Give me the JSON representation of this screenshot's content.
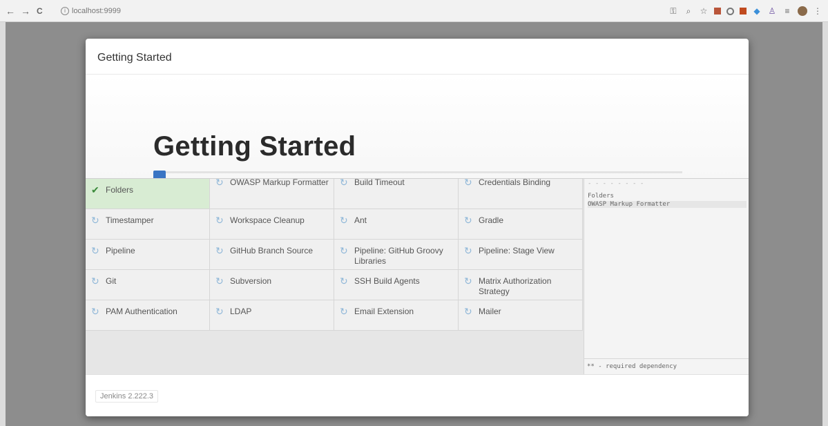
{
  "browser": {
    "back": "←",
    "forward": "→",
    "reload": "C",
    "info_glyph": "i",
    "url": "localhost:9999",
    "toolbar_icons": [
      "key-icon",
      "zoom-icon",
      "star-icon",
      "extension-icon",
      "extension-icon",
      "extension-icon",
      "extension-icon",
      "extension-icon",
      "reader-icon",
      "avatar"
    ]
  },
  "dialog": {
    "title": "Getting Started",
    "hero_title": "Getting Started",
    "plugins": [
      {
        "name": "Folders",
        "status": "done"
      },
      {
        "name": "OWASP Markup Formatter",
        "status": "pending"
      },
      {
        "name": "Build Timeout",
        "status": "pending"
      },
      {
        "name": "Credentials Binding",
        "status": "pending"
      },
      {
        "name": "Timestamper",
        "status": "pending"
      },
      {
        "name": "Workspace Cleanup",
        "status": "pending"
      },
      {
        "name": "Ant",
        "status": "pending"
      },
      {
        "name": "Gradle",
        "status": "pending"
      },
      {
        "name": "Pipeline",
        "status": "pending"
      },
      {
        "name": "GitHub Branch Source",
        "status": "pending"
      },
      {
        "name": "Pipeline: GitHub Groovy Libraries",
        "status": "pending"
      },
      {
        "name": "Pipeline: Stage View",
        "status": "pending"
      },
      {
        "name": "Git",
        "status": "pending"
      },
      {
        "name": "Subversion",
        "status": "pending"
      },
      {
        "name": "SSH Build Agents",
        "status": "pending"
      },
      {
        "name": "Matrix Authorization Strategy",
        "status": "pending"
      },
      {
        "name": "PAM Authentication",
        "status": "pending"
      },
      {
        "name": "LDAP",
        "status": "pending"
      },
      {
        "name": "Email Extension",
        "status": "pending"
      },
      {
        "name": "Mailer",
        "status": "pending"
      }
    ],
    "log_lines": [
      "Folders",
      "OWASP Markup Formatter"
    ],
    "log_footer": "** - required dependency",
    "version": "Jenkins 2.222.3"
  },
  "colors": {
    "done_bg": "#d8ecd3",
    "check": "#3a8a3a",
    "spinner": "#8fb7d8",
    "progress": "#3a75c4"
  }
}
